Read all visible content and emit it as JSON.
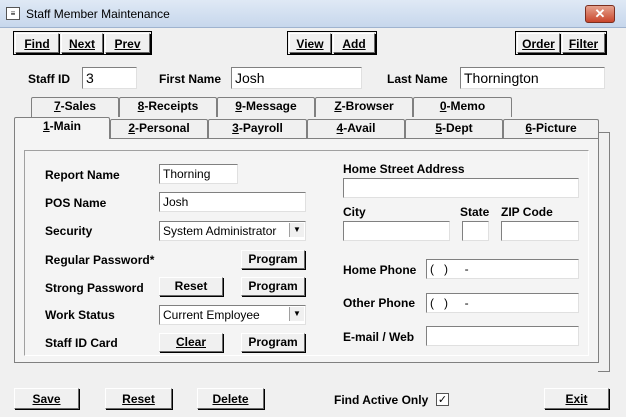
{
  "window": {
    "title": "Staff Member Maintenance",
    "app_icon": "window-icon",
    "close_symbol": "✕"
  },
  "toolbar": {
    "find_label": "Find",
    "next_label": "Next",
    "prev_label": "Prev",
    "view_label": "View",
    "add_label": "Add",
    "order_label": "Order",
    "filter_label": "Filter"
  },
  "header": {
    "staff_id_label": "Staff ID",
    "staff_id_value": "3",
    "first_name_label": "First Name",
    "first_name_value": "Josh",
    "last_name_label": "Last Name",
    "last_name_value": "Thornington"
  },
  "tabs_back": [
    {
      "key": "7",
      "label": "-Sales"
    },
    {
      "key": "8",
      "label": "-Receipts"
    },
    {
      "key": "9",
      "label": "-Message"
    },
    {
      "key": "Z",
      "label": "-Browser"
    },
    {
      "key": "0",
      "label": "-Memo"
    }
  ],
  "tabs_front": [
    {
      "key": "1",
      "label": "-Main"
    },
    {
      "key": "2",
      "label": "-Personal"
    },
    {
      "key": "3",
      "label": "-Payroll"
    },
    {
      "key": "4",
      "label": "-Avail"
    },
    {
      "key": "5",
      "label": "-Dept"
    },
    {
      "key": "6",
      "label": "-Picture"
    }
  ],
  "main": {
    "report_name_label": "Report Name",
    "report_name_value": "Thorning",
    "pos_name_label": "POS Name",
    "pos_name_value": "Josh",
    "security_label": "Security",
    "security_value": "System Administrator",
    "regular_password_label": "Regular Password*",
    "strong_password_label": "Strong Password",
    "work_status_label": "Work Status",
    "work_status_value": "Current Employee",
    "staff_id_card_label": "Staff ID Card",
    "program_label": "Program",
    "reset_label": "Reset",
    "clear_label": "Clear",
    "home_street_label": "Home Street Address",
    "home_street_value": "",
    "city_label": "City",
    "state_label": "State",
    "zip_label": "ZIP Code",
    "home_phone_label": "Home Phone",
    "home_phone_value": "(   )     -",
    "other_phone_label": "Other Phone",
    "other_phone_value": "(   )     -",
    "email_label": "E-mail / Web",
    "email_value": ""
  },
  "footer": {
    "save_label": "Save",
    "reset_label": "Reset",
    "delete_label": "Delete",
    "find_active_label": "Find Active Only",
    "find_active_checked": true,
    "exit_label": "Exit"
  }
}
